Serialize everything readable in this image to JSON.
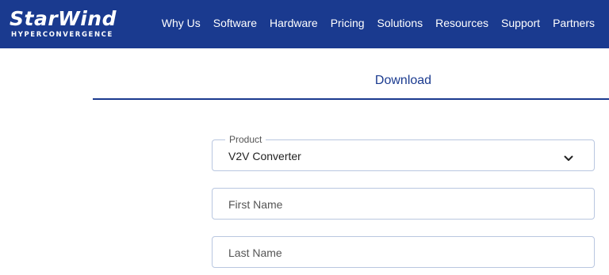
{
  "header": {
    "logo_word": "StarWind",
    "logo_sub": "HYPERCONVERGENCE",
    "nav": [
      "Why Us",
      "Software",
      "Hardware",
      "Pricing",
      "Solutions",
      "Resources",
      "Support",
      "Partners"
    ]
  },
  "tabs": {
    "download": "Download"
  },
  "form": {
    "product_label": "Product",
    "product_value": "V2V Converter",
    "first_name_placeholder": "First Name",
    "last_name_placeholder": "Last Name"
  },
  "colors": {
    "brand": "#1a3a8f",
    "field_border": "#b9c7e0"
  }
}
